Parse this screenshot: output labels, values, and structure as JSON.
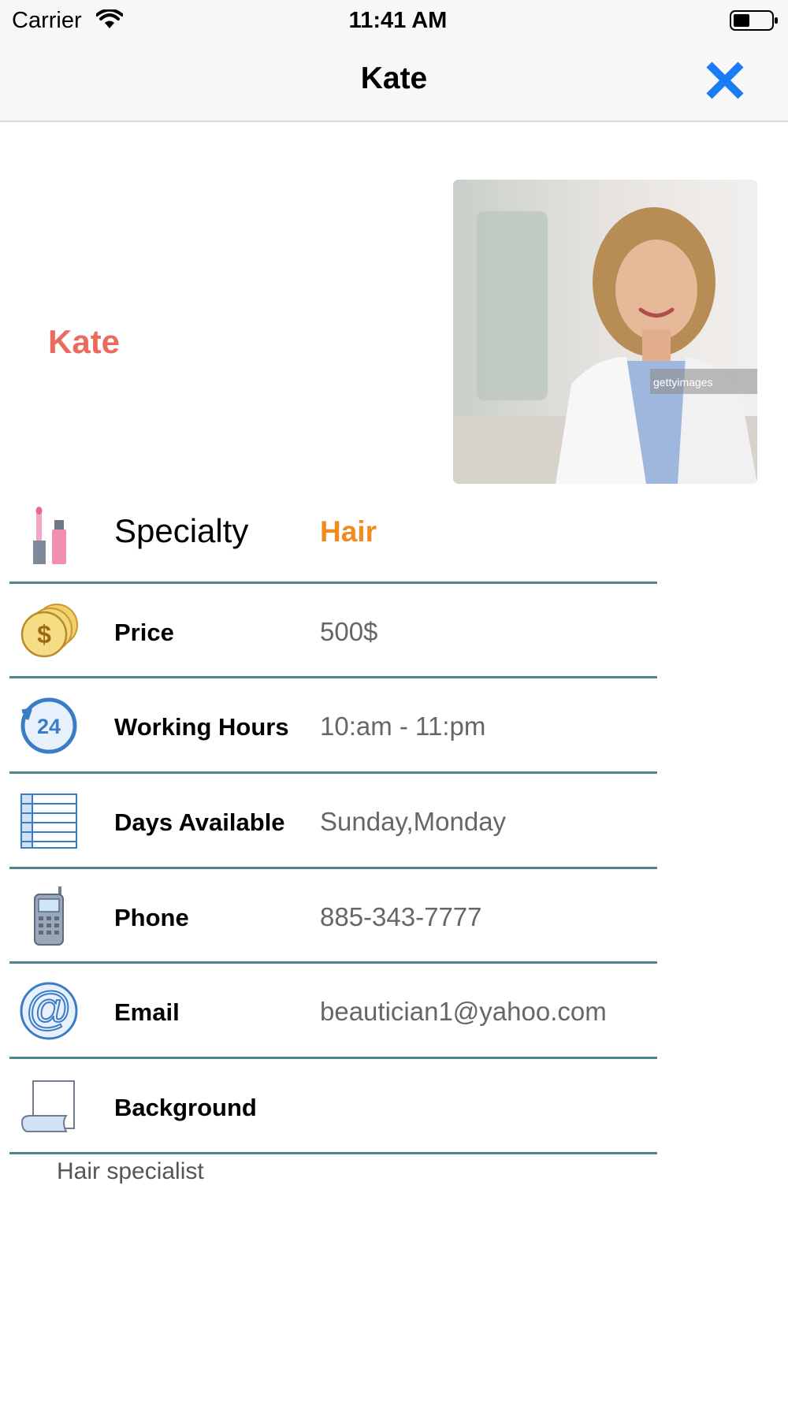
{
  "status_bar": {
    "carrier": "Carrier",
    "time": "11:41 AM"
  },
  "nav": {
    "title": "Kate",
    "close_icon": "close-x-icon"
  },
  "profile": {
    "name": "Kate",
    "photo_icon": "portrait-photo",
    "watermark": "gettyimages"
  },
  "details": [
    {
      "icon": "cosmetics-icon",
      "label": "Specialty",
      "value": "Hair"
    },
    {
      "icon": "coins-icon",
      "label": "Price",
      "value": "500$"
    },
    {
      "icon": "24-hours-icon",
      "label": "Working Hours",
      "value": "10:am - 11:pm"
    },
    {
      "icon": "calendar-list-icon",
      "label": "Days Available",
      "value": "Sunday,Monday"
    },
    {
      "icon": "phone-icon",
      "label": "Phone",
      "value": "885-343-7777"
    },
    {
      "icon": "email-icon",
      "label": "Email",
      "value": "beautician1@yahoo.com"
    },
    {
      "icon": "scroll-icon",
      "label": "Background",
      "value": ""
    }
  ],
  "background_text": "Hair specialist",
  "colors": {
    "name": "#ea6a5e",
    "specialty_value": "#f28a22",
    "divider": "#4f8491",
    "close": "#1a7cf5"
  }
}
